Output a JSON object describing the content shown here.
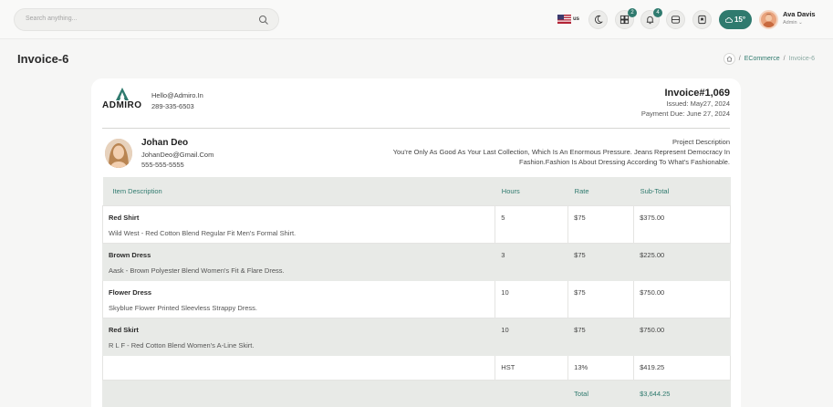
{
  "header": {
    "search_placeholder": "Search anything...",
    "language": "us",
    "grid_badge": "2",
    "bell_badge": "4",
    "weather_temp": "15°",
    "user_name": "Ava Davis",
    "user_role": "Admin"
  },
  "page": {
    "title": "Invoice-6",
    "breadcrumb": [
      "ECommerce",
      "Invoice-6"
    ]
  },
  "invoice": {
    "brand": "ADMIRO",
    "email": "Hello@Admiro.In",
    "phone": "289-335-6503",
    "number": "Invoice#1,069",
    "issued": "Issued: May27, 2024",
    "due": "Payment Due: June 27, 2024",
    "client": {
      "name": "Johan Deo",
      "email": "JohanDeo@Gmail.Com",
      "phone": "555-555-5555"
    },
    "project_label": "Project Description",
    "project_text_1": "You're Only As Good As Your Last Collection, Which Is An Enormous Pressure. Jeans Represent Democracy In",
    "project_text_2": "Fashion.Fashion Is About Dressing According To What's Fashionable.",
    "columns": [
      "Item Description",
      "Hours",
      "Rate",
      "Sub-Total"
    ],
    "items": [
      {
        "name": "Red Shirt",
        "desc": "Wild West - Red Cotton Blend Regular Fit Men's Formal Shirt.",
        "hours": "5",
        "rate": "$75",
        "subtotal": "$375.00"
      },
      {
        "name": "Brown Dress",
        "desc": "Aask - Brown Polyester Blend Women's Fit & Flare Dress.",
        "hours": "3",
        "rate": "$75",
        "subtotal": "$225.00"
      },
      {
        "name": "Flower Dress",
        "desc": "Skyblue Flower Printed Sleevless Strappy Dress.",
        "hours": "10",
        "rate": "$75",
        "subtotal": "$750.00"
      },
      {
        "name": "Red Skirt",
        "desc": "R L F - Red Cotton Blend Women's A-Line Skirt.",
        "hours": "10",
        "rate": "$75",
        "subtotal": "$750.00"
      }
    ],
    "tax": {
      "label": "HST",
      "rate": "13%",
      "amount": "$419.25"
    },
    "total": {
      "label": "Total",
      "amount": "$3,644.25"
    }
  },
  "colors": {
    "accent": "#2f7a6e",
    "shade": "#e8eae7"
  }
}
